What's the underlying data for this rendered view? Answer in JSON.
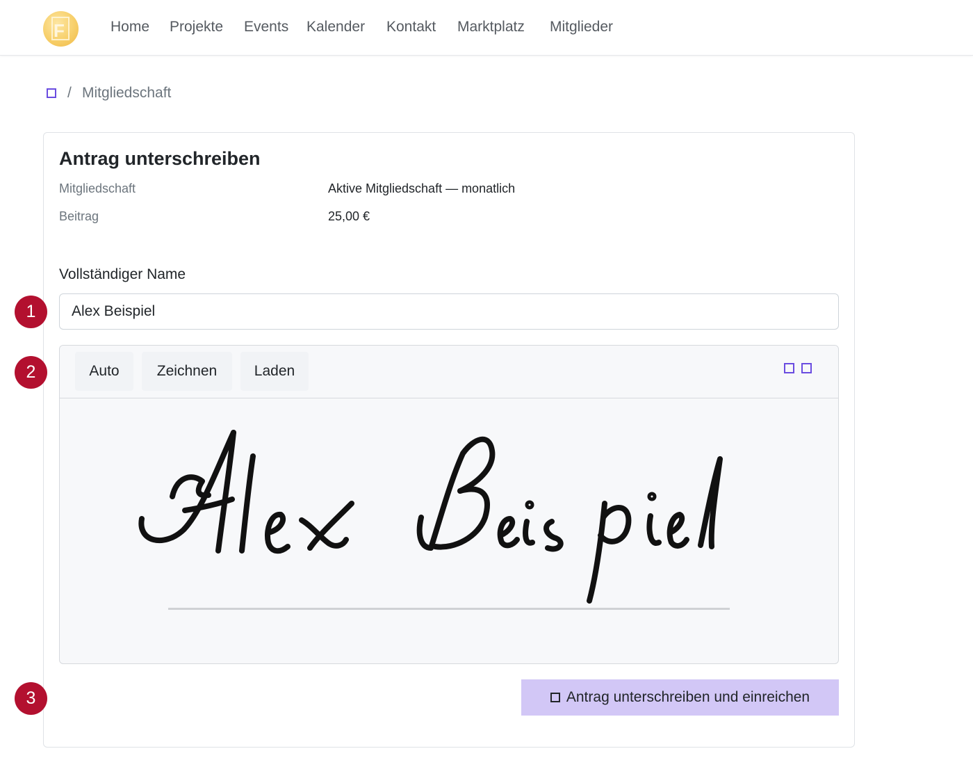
{
  "nav": {
    "logo_letter": "F",
    "links": [
      "Home",
      "Projekte",
      "Events",
      "Kalender",
      "Kontakt",
      "Marktplatz",
      "Mitglieder"
    ]
  },
  "breadcrumb": {
    "home_icon": "home-icon",
    "separator": "/",
    "current": "Mitgliedschaft"
  },
  "card": {
    "title": "Antrag unterschreiben",
    "rows": [
      {
        "label": "Mitgliedschaft",
        "value": "Aktive Mitgliedschaft — monatlich"
      },
      {
        "label": "Beitrag",
        "value": "25,00 €"
      }
    ]
  },
  "form": {
    "name_label": "Vollständiger Name",
    "name_value": "Alex Beispiel"
  },
  "signature": {
    "tabs": [
      "Auto",
      "Zeichnen",
      "Laden"
    ],
    "actions": [
      "undo-icon",
      "clear-icon"
    ],
    "signed_name": "Alex Beispiel"
  },
  "submit": {
    "icon": "check-square-icon",
    "label": "Antrag unterschreiben und einreichen"
  },
  "steps": [
    "1",
    "2",
    "3"
  ],
  "colors": {
    "accent": "#6a4ce0",
    "submit_bg": "#d2c7f6",
    "step_badge": "#b3102f"
  }
}
